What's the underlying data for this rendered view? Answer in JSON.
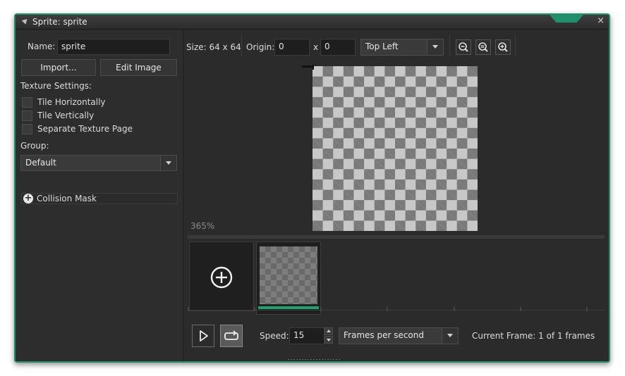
{
  "window": {
    "title": "Sprite: sprite",
    "close_glyph": "×",
    "accent": "#1f8f6c"
  },
  "left": {
    "name_label": "Name:",
    "name_value": "sprite",
    "import_label": "Import...",
    "edit_label": "Edit Image",
    "texture_heading": "Texture Settings:",
    "checkboxes": [
      {
        "label": "Tile Horizontally",
        "checked": false
      },
      {
        "label": "Tile Vertically",
        "checked": false
      },
      {
        "label": "Separate Texture Page",
        "checked": false
      }
    ],
    "group_label": "Group:",
    "group_value": "Default",
    "collision_label": "Collision Mask",
    "collision_glyph": "+"
  },
  "toolbar": {
    "size_text": "Size: 64 x 64",
    "origin_label": "Origin:",
    "origin_x": "0",
    "origin_sep": "x",
    "origin_y": "0",
    "origin_preset": "Top Left",
    "zoom_icons": [
      "zoom-out-icon",
      "zoom-reset-icon",
      "zoom-in-icon"
    ]
  },
  "canvas": {
    "zoom_text": "365%"
  },
  "frames": {
    "count": 1,
    "selected": 1,
    "selected_color": "#1ea36f"
  },
  "playback": {
    "speed_label": "Speed:",
    "speed_value": "15",
    "speed_unit": "Frames per second",
    "current_frame": "Current Frame: 1 of 1 frames",
    "loop_active": true
  }
}
